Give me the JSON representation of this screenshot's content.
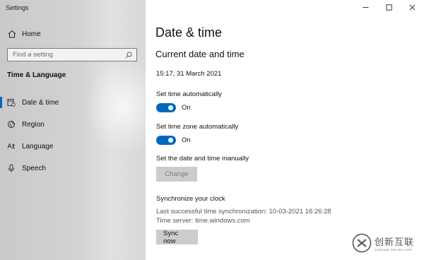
{
  "app": {
    "title": "Settings"
  },
  "sidebar": {
    "home_label": "Home",
    "search_placeholder": "Find a setting",
    "section_title": "Time & Language",
    "items": [
      {
        "label": "Date & time",
        "icon": "calendar-clock-icon",
        "active": true
      },
      {
        "label": "Region",
        "icon": "globe-icon",
        "active": false
      },
      {
        "label": "Language",
        "icon": "language-icon",
        "active": false
      },
      {
        "label": "Speech",
        "icon": "microphone-icon",
        "active": false
      }
    ]
  },
  "main": {
    "page_title": "Date & time",
    "sub_title": "Current date and time",
    "current_datetime": "15:17, 31 March 2021",
    "set_time_auto": {
      "label": "Set time automatically",
      "state": "On"
    },
    "set_timezone_auto": {
      "label": "Set time zone automatically",
      "state": "On"
    },
    "manual": {
      "label": "Set the date and time manually",
      "button": "Change"
    },
    "sync": {
      "title": "Synchronize your clock",
      "last_sync": "Last successful time synchronization: 10-03-2021 16:26:28",
      "server": "Time server: time.windows.com",
      "button": "Sync now"
    }
  },
  "watermark": {
    "text_cn": "创新互联",
    "text_en": "CHUANG XIN HU LIAN"
  },
  "colors": {
    "accent": "#0067c0",
    "sidebar_bg": "#d3d3d3",
    "button_bg": "#cccccc"
  }
}
